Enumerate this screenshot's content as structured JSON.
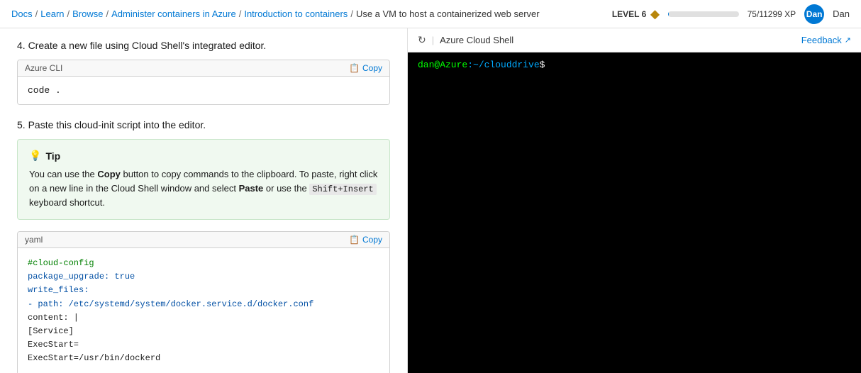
{
  "nav": {
    "docs": "Docs",
    "learn": "Learn",
    "browse": "Browse",
    "adminContainers": "Administer containers in Azure",
    "introContainers": "Introduction to containers",
    "useVM": "Use a VM to host a containerized web server",
    "level": "LEVEL 6",
    "xp": "75/11299 XP",
    "xp_percent": 0.66,
    "user": "Dan"
  },
  "content": {
    "step4_heading": "4. Create a new file using Cloud Shell's integrated editor.",
    "step4_lang": "Azure CLI",
    "step4_copy": "Copy",
    "step4_code": "code .",
    "step5_heading": "5. Paste this cloud-init script into the editor.",
    "tip_label": "Tip",
    "tip_text_1": "You can use the ",
    "tip_copy_word": "Copy",
    "tip_text_2": " button to copy commands to the clipboard. To paste, right click on a new line in the Cloud Shell window and select ",
    "tip_paste_word": "Paste",
    "tip_text_3": " or use the ",
    "tip_shortcut": "Shift+Insert",
    "tip_text_4": " keyboard shortcut.",
    "yaml_lang": "yaml",
    "yaml_copy": "Copy",
    "yaml_line1": "#cloud-config",
    "yaml_line2": "package_upgrade: true",
    "yaml_line3": "write_files:",
    "yaml_line4": "  - path: /etc/systemd/system/docker.service.d/docker.conf",
    "yaml_line5": "    content: |",
    "yaml_line6": "      [Service]",
    "yaml_line7": "      ExecStart=",
    "yaml_line8": "      ExecStart=/usr/bin/dockerd"
  },
  "shell": {
    "title": "Azure Cloud Shell",
    "feedback": "Feedback",
    "prompt_user": "dan@Azure",
    "prompt_path": ":~/clouddrive",
    "prompt_dollar": "$"
  }
}
